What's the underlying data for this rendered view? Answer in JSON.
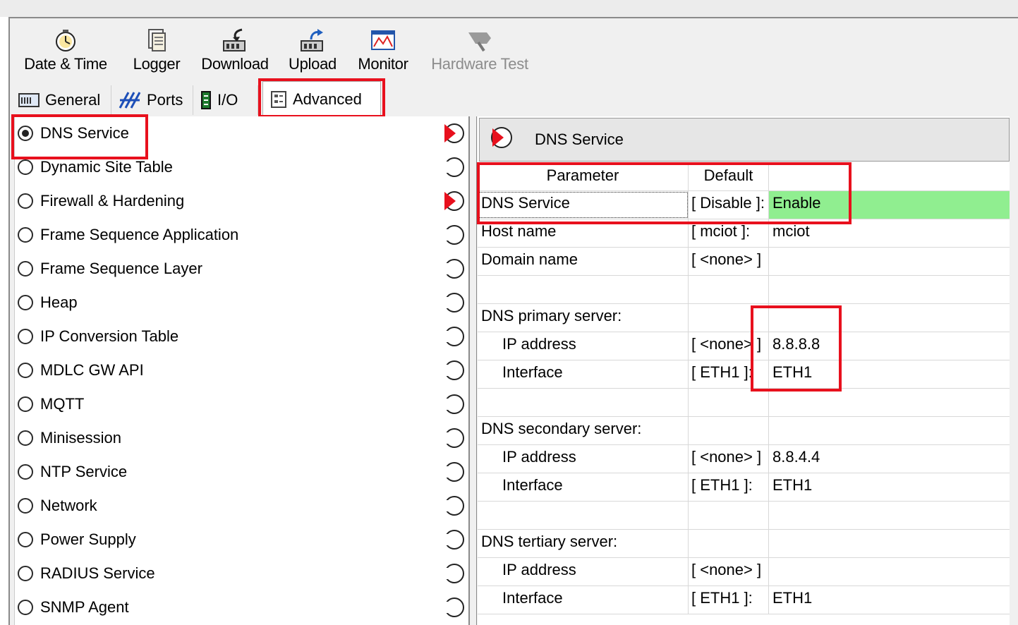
{
  "toolbar": {
    "date_time": "Date & Time",
    "logger": "Logger",
    "download": "Download",
    "upload": "Upload",
    "monitor": "Monitor",
    "hardware_test": "Hardware Test"
  },
  "tabs": {
    "general": "General",
    "ports": "Ports",
    "io": "I/O",
    "advanced": "Advanced"
  },
  "services": [
    "DNS Service",
    "Dynamic Site Table",
    "Firewall & Hardening",
    "Frame Sequence Application",
    "Frame Sequence Layer",
    "Heap",
    "IP Conversion Table",
    "MDLC GW API",
    "MQTT",
    "Minisession",
    "NTP Service",
    "Network",
    "Power Supply",
    "RADIUS Service",
    "SNMP Agent"
  ],
  "selected_service": "DNS Service",
  "panel": {
    "title": "DNS Service",
    "headers": {
      "parameter": "Parameter",
      "default": "Default",
      "value": ""
    },
    "rows": [
      {
        "param": "DNS Service",
        "default": "[ Disable ]:",
        "value": "Enable"
      },
      {
        "param": "Host name",
        "default": "[ mciot ]:",
        "value": "mciot"
      },
      {
        "param": "Domain name",
        "default": "[ <none> ]",
        "value": ""
      },
      {
        "param": "",
        "default": "",
        "value": ""
      },
      {
        "param": "DNS primary server:",
        "default": "",
        "value": ""
      },
      {
        "param": "IP address",
        "default": "[ <none> ]",
        "value": "8.8.8.8"
      },
      {
        "param": "Interface",
        "default": "[ ETH1 ]:",
        "value": "ETH1"
      },
      {
        "param": "",
        "default": "",
        "value": ""
      },
      {
        "param": "DNS secondary server:",
        "default": "",
        "value": ""
      },
      {
        "param": "IP address",
        "default": "[ <none> ]",
        "value": "8.8.4.4"
      },
      {
        "param": "Interface",
        "default": "[ ETH1 ]:",
        "value": "ETH1"
      },
      {
        "param": "",
        "default": "",
        "value": ""
      },
      {
        "param": "DNS tertiary server:",
        "default": "",
        "value": ""
      },
      {
        "param": "IP address",
        "default": "[ <none> ]",
        "value": ""
      },
      {
        "param": "Interface",
        "default": "[ ETH1 ]:",
        "value": "ETH1"
      }
    ]
  },
  "colors": {
    "highlight_red": "#e8101d",
    "enabled_green": "#90ee90"
  }
}
